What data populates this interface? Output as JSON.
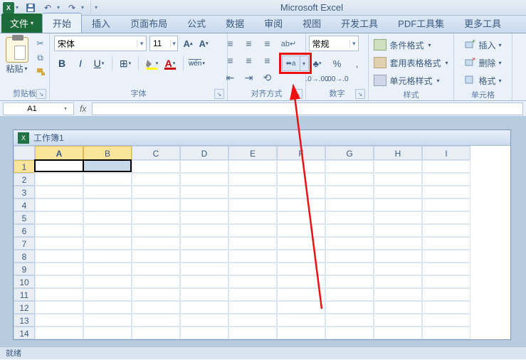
{
  "app_title": "Microsoft Excel",
  "qat": {
    "save_tip": "保存",
    "undo_tip": "撤销",
    "redo_tip": "重做"
  },
  "tabs": {
    "file": "文件",
    "home": "开始",
    "insert": "插入",
    "layout": "页面布局",
    "formula": "公式",
    "data": "数据",
    "review": "审阅",
    "view": "视图",
    "dev": "开发工具",
    "pdf": "PDF工具集",
    "more": "更多工具"
  },
  "ribbon": {
    "clipboard": {
      "paste": "粘贴",
      "label": "剪贴板"
    },
    "font": {
      "name": "宋体",
      "size": "11",
      "label": "字体"
    },
    "alignment": {
      "label": "对齐方式"
    },
    "number": {
      "format": "常规",
      "label": "数字"
    },
    "styles": {
      "cond": "条件格式",
      "table": "套用表格格式",
      "cell": "单元格样式",
      "label": "样式"
    },
    "cells": {
      "insert": "插入",
      "delete": "删除",
      "format": "格式",
      "label": "单元格"
    }
  },
  "namebox": "A1",
  "workbook_title": "工作簿1",
  "columns": [
    "A",
    "B",
    "C",
    "D",
    "E",
    "F",
    "G",
    "H",
    "I"
  ],
  "rows": [
    "1",
    "2",
    "3",
    "4",
    "5",
    "6",
    "7",
    "8",
    "9",
    "10",
    "11",
    "12",
    "13",
    "14"
  ],
  "status": "就绪"
}
